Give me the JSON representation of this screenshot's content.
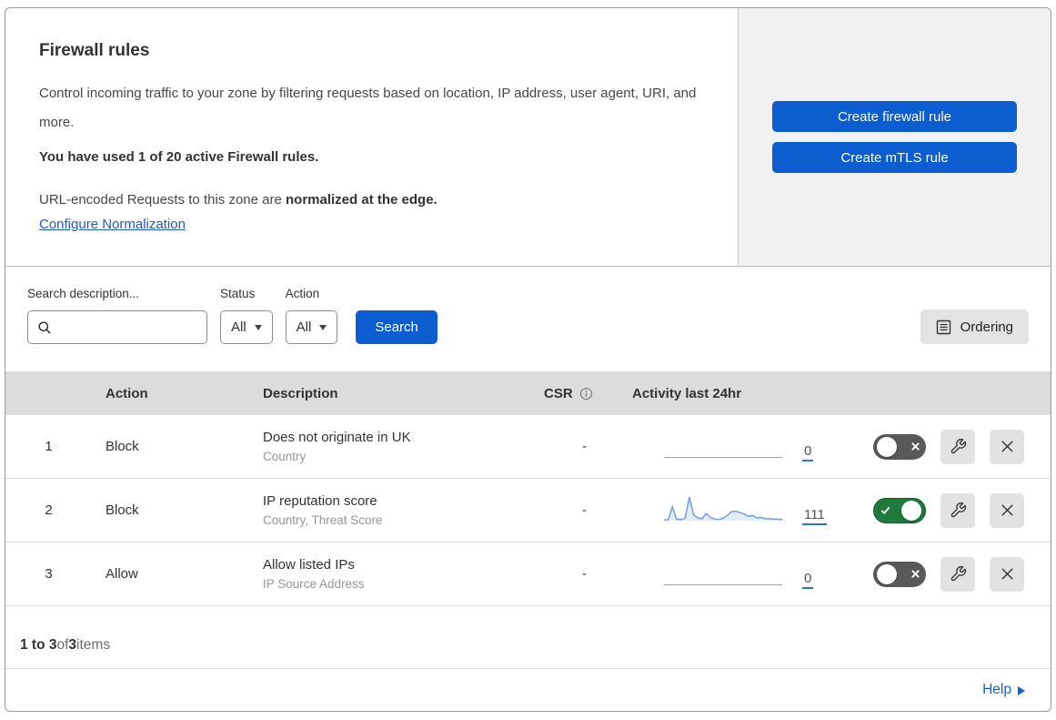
{
  "header": {
    "title": "Firewall rules",
    "description": "Control incoming traffic to your zone by filtering requests based on location, IP address, user agent, URI, and more.",
    "usage": "You have used 1 of 20 active Firewall rules.",
    "normalization_text": "URL-encoded Requests to this zone are ",
    "normalization_bold": "normalized at the edge.",
    "normalization_link": "Configure Normalization",
    "create_firewall_button": "Create firewall rule",
    "create_mtls_button": "Create mTLS rule"
  },
  "filters": {
    "search_label": "Search description...",
    "status_label": "Status",
    "status_value": "All",
    "action_label": "Action",
    "action_value": "All",
    "search_button": "Search",
    "ordering_button": "Ordering"
  },
  "table": {
    "columns": {
      "action": "Action",
      "description": "Description",
      "csr": "CSR",
      "activity": "Activity last 24hr"
    },
    "rows": [
      {
        "num": "1",
        "action": "Block",
        "description": "Does not originate in UK",
        "fields": "Country",
        "csr": "-",
        "activity_count": "0",
        "enabled": false
      },
      {
        "num": "2",
        "action": "Block",
        "description": "IP reputation score",
        "fields": "Country, Threat Score",
        "csr": "-",
        "activity_count": "111",
        "enabled": true,
        "sparkline": [
          3,
          4,
          58,
          6,
          4,
          10,
          100,
          25,
          12,
          8,
          30,
          14,
          7,
          5,
          10,
          22,
          38,
          40,
          34,
          28,
          18,
          22,
          12,
          14,
          8,
          8,
          6,
          6,
          5
        ]
      },
      {
        "num": "3",
        "action": "Allow",
        "description": "Allow listed IPs",
        "fields": "IP Source Address",
        "csr": "-",
        "activity_count": "0",
        "enabled": false
      }
    ],
    "footer": {
      "range": "1 to 3",
      "of": " of ",
      "total": "3",
      "items": " items"
    }
  },
  "help": {
    "label": "Help"
  },
  "colors": {
    "primary_blue": "#0b5dd0",
    "toggle_on_green": "#1e7b3c",
    "toggle_off_gray": "#595959",
    "sparkline_blue": "#6f9fe8",
    "link_blue": "#2257c5",
    "header_gray": "#dcdcdc",
    "panel_gray": "#f1f1f1"
  }
}
